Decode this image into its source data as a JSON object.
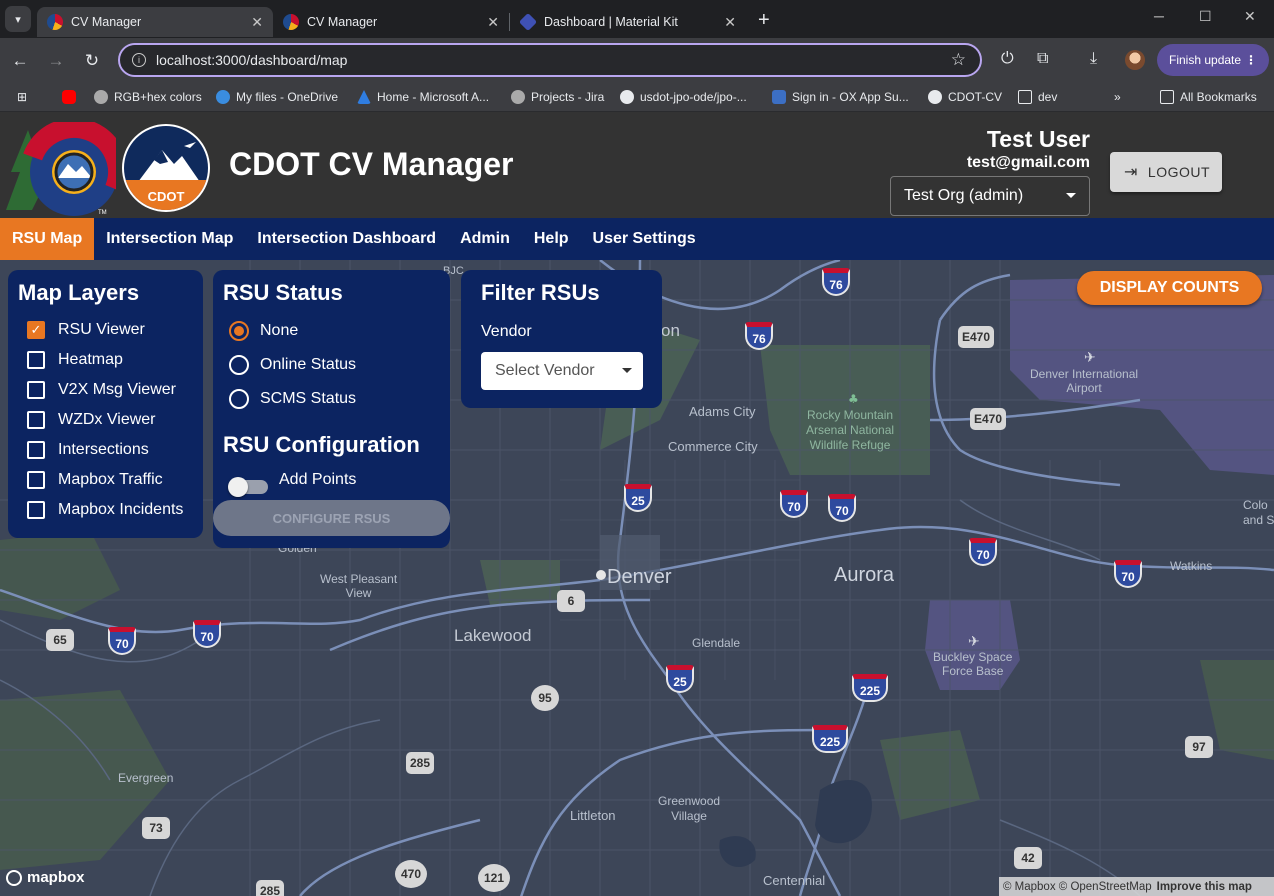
{
  "browser": {
    "tabs": [
      {
        "title": "CV Manager",
        "active": true
      },
      {
        "title": "CV Manager",
        "active": false
      },
      {
        "title": "Dashboard | Material Kit",
        "active": false
      }
    ],
    "url": "localhost:3000/dashboard/map",
    "finish_update": "Finish update",
    "bookmarks": [
      "RGB+hex colors",
      "My files - OneDrive",
      "Home - Microsoft A...",
      "Projects - Jira",
      "usdot-jpo-ode/jpo-...",
      "Sign in - OX App Su...",
      "CDOT-CV",
      "dev",
      "All Bookmarks"
    ]
  },
  "header": {
    "logo_text": "CDOT",
    "title": "CDOT CV Manager",
    "user_name": "Test User",
    "user_email": "test@gmail.com",
    "org_selected": "Test Org (admin)",
    "logout_label": "LOGOUT"
  },
  "nav": {
    "items": [
      "RSU Map",
      "Intersection Map",
      "Intersection Dashboard",
      "Admin",
      "Help",
      "User Settings"
    ],
    "active": "RSU Map"
  },
  "map_layers": {
    "title": "Map Layers",
    "items": [
      {
        "label": "RSU Viewer",
        "checked": true
      },
      {
        "label": "Heatmap",
        "checked": false
      },
      {
        "label": "V2X Msg Viewer",
        "checked": false
      },
      {
        "label": "WZDx Viewer",
        "checked": false
      },
      {
        "label": "Intersections",
        "checked": false
      },
      {
        "label": "Mapbox Traffic",
        "checked": false
      },
      {
        "label": "Mapbox Incidents",
        "checked": false
      }
    ]
  },
  "rsu_status": {
    "title": "RSU Status",
    "options": [
      {
        "label": "None",
        "selected": true
      },
      {
        "label": "Online Status",
        "selected": false
      },
      {
        "label": "SCMS Status",
        "selected": false
      }
    ],
    "config_title": "RSU Configuration",
    "add_points_label": "Add Points",
    "add_points_on": false,
    "configure_label": "CONFIGURE RSUS"
  },
  "filter": {
    "title": "Filter RSUs",
    "vendor_label": "Vendor",
    "vendor_placeholder": "Select Vendor"
  },
  "display_counts_label": "DISPLAY COUNTS",
  "map": {
    "places": {
      "denver": "Denver",
      "aurora": "Aurora",
      "lakewood": "Lakewood",
      "adams_city": "Adams City",
      "commerce_city": "Commerce City",
      "rmanwr": "Rocky Mountain\nArsenal National\nWildlife Refuge",
      "dia": "Denver International\nAirport",
      "buckley": "Buckley Space\nForce Base",
      "glendale": "Glendale",
      "west_pleasant_view": "West Pleasant\nView",
      "golden": "Golden",
      "evergreen": "Evergreen",
      "littleton": "Littleton",
      "greenwood": "Greenwood\nVillage",
      "centennial": "Centennial",
      "watkins": "Watkins",
      "colo_and": "Colo\nand S",
      "on": "on",
      "bjc": "BJC"
    },
    "interstate_shields": [
      "76",
      "76",
      "25",
      "25",
      "70",
      "70",
      "70",
      "70",
      "70",
      "70",
      "225",
      "225"
    ],
    "route_markers": [
      "E470",
      "E470",
      "6",
      "65",
      "95",
      "285",
      "73",
      "470",
      "121",
      "285",
      "42",
      "97"
    ],
    "logo": "mapbox",
    "attribution": "© Mapbox © OpenStreetMap",
    "improve": "Improve this map"
  }
}
